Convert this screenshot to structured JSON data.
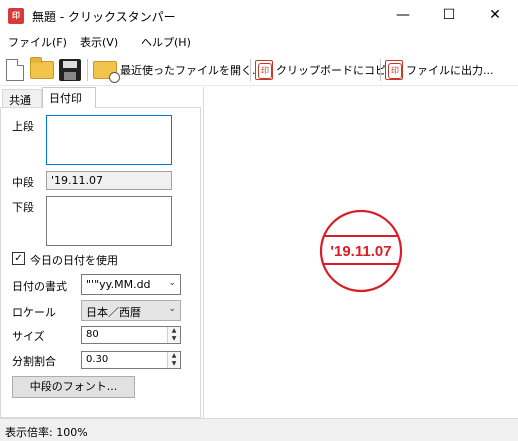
{
  "window": {
    "title": "無題 - クリックスタンパー",
    "minimize": "—",
    "maximize": "☐",
    "close": "✕"
  },
  "menu": [
    {
      "label": "ファイル(F)"
    },
    {
      "label": "表示(V)"
    },
    {
      "label": "ヘルプ(H)"
    }
  ],
  "toolbar": {
    "new_icon": "new-file-icon",
    "open_icon": "open-folder-icon",
    "save_icon": "save-disk-icon",
    "recent_label": "最近使ったファイルを開く...",
    "copy_label": "クリップボードにコピー",
    "output_label": "ファイルに出力..."
  },
  "tabs": [
    {
      "label": "共通"
    },
    {
      "label": "日付印"
    }
  ],
  "form": {
    "upper_label": "上段",
    "upper_value": "",
    "middle_label": "中段",
    "middle_value": "'19.11.07",
    "lower_label": "下段",
    "lower_value": "",
    "use_today_label": "今日の日付を使用",
    "use_today_checked": true,
    "date_format_label": "日付の書式",
    "date_format_value": "\"'\"yy.MM.dd",
    "locale_label": "ロケール",
    "locale_value": "日本／西暦",
    "size_label": "サイズ",
    "size_value": "80",
    "split_label": "分割割合",
    "split_value": "0.30",
    "font_button": "中段のフォント..."
  },
  "stamp": {
    "middle_text": "'19.11.07",
    "color": "#d61f26"
  },
  "status": {
    "zoom_text": "表示倍率: 100%"
  }
}
